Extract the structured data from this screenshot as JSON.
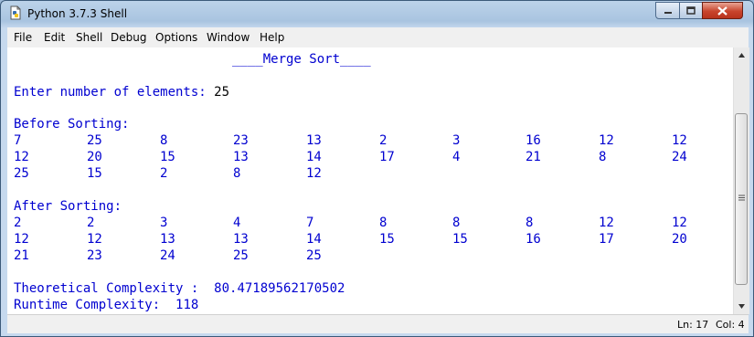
{
  "window": {
    "title": "Python 3.7.3 Shell"
  },
  "menu": [
    "File",
    "Edit",
    "Shell",
    "Debug",
    "Options",
    "Window",
    "Help"
  ],
  "console": {
    "header_prefix": "____",
    "header_title": "Merge Sort",
    "header_suffix": "____",
    "prompt_label": "Enter number of elements:",
    "prompt_value": "25",
    "before_label": "Before Sorting:",
    "before_rows": [
      [
        "7",
        "25",
        "8",
        "23",
        "13",
        "2",
        "3",
        "16",
        "12",
        "12"
      ],
      [
        "12",
        "20",
        "15",
        "13",
        "14",
        "17",
        "4",
        "21",
        "8",
        "24"
      ],
      [
        "25",
        "15",
        "2",
        "8",
        "12"
      ]
    ],
    "after_label": "After Sorting:",
    "after_rows": [
      [
        "2",
        "2",
        "3",
        "4",
        "7",
        "8",
        "8",
        "8",
        "12",
        "12"
      ],
      [
        "12",
        "12",
        "13",
        "13",
        "14",
        "15",
        "15",
        "16",
        "17",
        "20"
      ],
      [
        "21",
        "23",
        "24",
        "25",
        "25"
      ]
    ],
    "theoretical_label": "Theoretical Complexity :",
    "theoretical_value": "80.47189562170502",
    "runtime_label": "Runtime Complexity:",
    "runtime_value": "118"
  },
  "status": {
    "line": "Ln: 17",
    "col": "Col: 4"
  }
}
